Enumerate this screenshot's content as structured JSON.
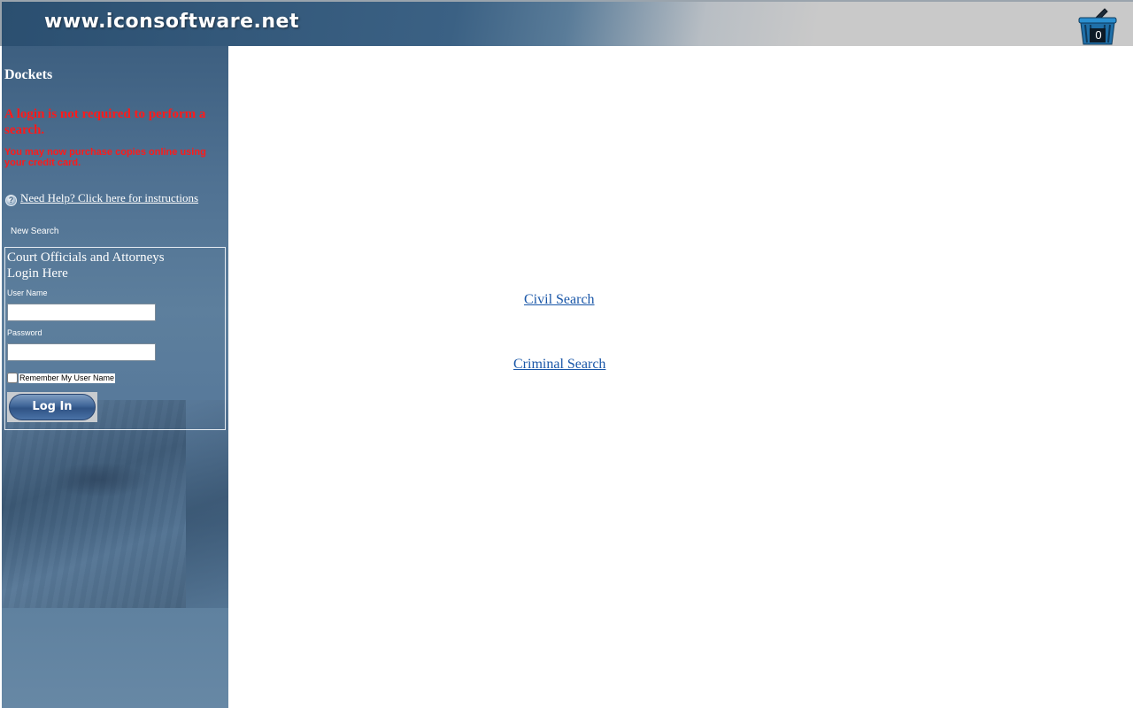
{
  "header": {
    "site_title": "www.iconsoftware.net",
    "cart_count": "0",
    "cart_icon": "basket-icon"
  },
  "sidebar": {
    "section_title": "Dockets",
    "login_notice": "A login is not required to perform a search.",
    "purchase_notice": "You may now purchase copies online using your credit card.",
    "help_icon": "help-circle-icon",
    "help_link": "Need Help? Click here for instructions",
    "new_search": "New Search",
    "login": {
      "title_line1": "Court Officials and Attorneys",
      "title_line2": "Login Here",
      "username_label": "User Name",
      "username_value": "",
      "password_label": "Password",
      "password_value": "",
      "remember_label": "Remember My User Name",
      "login_button": "Log In"
    }
  },
  "main": {
    "civil_search": "Civil Search",
    "criminal_search": "Criminal Search"
  },
  "colors": {
    "header_blue": "#2b4f70",
    "sidebar_blue": "#4f7192",
    "notice_red": "#ff1a1a",
    "link_blue": "#1a57a8"
  }
}
